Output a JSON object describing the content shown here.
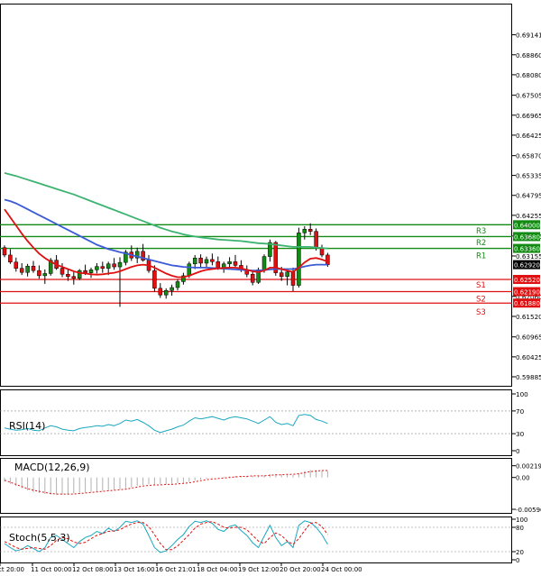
{
  "chart_data": [
    {
      "type": "candlestick",
      "title": "",
      "ylim": [
        0.59885,
        0.69741
      ],
      "y_ticks": [
        "0.69141",
        "0.68860",
        "0.68080",
        "0.67505",
        "0.66965",
        "0.66425",
        "0.65870",
        "0.65335",
        "0.64795",
        "0.64255",
        "0.63695",
        "0.63155",
        "0.62060",
        "0.61520",
        "0.60965",
        "0.60425",
        "0.59885"
      ],
      "x_tick_labels": [
        "ct 20:00",
        "11 Oct 00:00",
        "12 Oct 08:00",
        "13 Oct 16:00",
        "16 Oct 21:01",
        "18 Oct 04:00",
        "19 Oct 12:00",
        "20 Oct 20:00",
        "24 Oct 00:00"
      ],
      "levels": [
        {
          "name": "R3",
          "value": 0.64,
          "label": "0.64000",
          "color": "#138a13"
        },
        {
          "name": "",
          "value": 0.6368,
          "label": "0.63680",
          "color": "#138a13"
        },
        {
          "name": "R2",
          "value": 0.6336,
          "label": "0.63360",
          "color": "#138a13"
        },
        {
          "name": "R1",
          "value": 0.6336,
          "label": "",
          "color": "#138a13"
        },
        {
          "name": "S1",
          "value": 0.6252,
          "label": "0.62520",
          "color": "#e01010"
        },
        {
          "name": "S2",
          "value": 0.6219,
          "label": "0.62190",
          "color": "#e01010"
        },
        {
          "name": "S3",
          "value": 0.6188,
          "label": "0.61880",
          "color": "#e01010"
        }
      ],
      "current_price": {
        "value": 0.6292,
        "label": "0.62920"
      },
      "candles": [
        [
          0.6338,
          0.6344,
          0.6312,
          0.6318
        ],
        [
          0.6318,
          0.6334,
          0.6294,
          0.6299
        ],
        [
          0.6299,
          0.6311,
          0.6273,
          0.6282
        ],
        [
          0.6282,
          0.6296,
          0.6264,
          0.6271
        ],
        [
          0.6271,
          0.6294,
          0.626,
          0.6288
        ],
        [
          0.6288,
          0.6302,
          0.627,
          0.6276
        ],
        [
          0.6276,
          0.629,
          0.6254,
          0.6262
        ],
        [
          0.6262,
          0.6279,
          0.624,
          0.6268
        ],
        [
          0.6268,
          0.631,
          0.6262,
          0.6304
        ],
        [
          0.6304,
          0.6318,
          0.6278,
          0.6282
        ],
        [
          0.6282,
          0.6296,
          0.6258,
          0.6266
        ],
        [
          0.6266,
          0.6281,
          0.6248,
          0.626
        ],
        [
          0.626,
          0.6272,
          0.6238,
          0.6255
        ],
        [
          0.6255,
          0.628,
          0.625,
          0.6276
        ],
        [
          0.6276,
          0.6292,
          0.6264,
          0.627
        ],
        [
          0.627,
          0.6284,
          0.6256,
          0.6278
        ],
        [
          0.6278,
          0.6296,
          0.6268,
          0.6287
        ],
        [
          0.6287,
          0.63,
          0.627,
          0.6282
        ],
        [
          0.6282,
          0.63,
          0.6264,
          0.6294
        ],
        [
          0.6294,
          0.631,
          0.6278,
          0.6286
        ],
        [
          0.6286,
          0.6312,
          0.6178,
          0.6298
        ],
        [
          0.6298,
          0.6332,
          0.629,
          0.6326
        ],
        [
          0.6326,
          0.6344,
          0.6302,
          0.631
        ],
        [
          0.631,
          0.6338,
          0.6296,
          0.6328
        ],
        [
          0.6328,
          0.6348,
          0.63,
          0.6304
        ],
        [
          0.6304,
          0.6318,
          0.627,
          0.6276
        ],
        [
          0.6276,
          0.629,
          0.6218,
          0.6228
        ],
        [
          0.6228,
          0.6242,
          0.6202,
          0.621
        ],
        [
          0.621,
          0.6228,
          0.62,
          0.6222
        ],
        [
          0.6222,
          0.6238,
          0.6208,
          0.623
        ],
        [
          0.623,
          0.6252,
          0.6222,
          0.6246
        ],
        [
          0.6246,
          0.627,
          0.6238,
          0.6262
        ],
        [
          0.6262,
          0.63,
          0.6256,
          0.6294
        ],
        [
          0.6294,
          0.6318,
          0.628,
          0.631
        ],
        [
          0.631,
          0.632,
          0.6286,
          0.6296
        ],
        [
          0.6296,
          0.6314,
          0.6284,
          0.6306
        ],
        [
          0.6306,
          0.6322,
          0.629,
          0.63
        ],
        [
          0.63,
          0.6314,
          0.6278,
          0.6284
        ],
        [
          0.6284,
          0.63,
          0.627,
          0.6294
        ],
        [
          0.6294,
          0.6312,
          0.6282,
          0.63
        ],
        [
          0.63,
          0.6318,
          0.6284,
          0.629
        ],
        [
          0.629,
          0.6304,
          0.6272,
          0.6278
        ],
        [
          0.6278,
          0.629,
          0.6258,
          0.6266
        ],
        [
          0.6266,
          0.6276,
          0.6236,
          0.6244
        ],
        [
          0.6244,
          0.6284,
          0.624,
          0.6278
        ],
        [
          0.6278,
          0.632,
          0.627,
          0.6314
        ],
        [
          0.6314,
          0.636,
          0.63,
          0.6352
        ],
        [
          0.6352,
          0.6356,
          0.6262,
          0.627
        ],
        [
          0.627,
          0.6286,
          0.6248,
          0.626
        ],
        [
          0.626,
          0.6278,
          0.6236,
          0.6272
        ],
        [
          0.6272,
          0.6284,
          0.622,
          0.6236
        ],
        [
          0.6236,
          0.6392,
          0.623,
          0.6378
        ],
        [
          0.6378,
          0.6396,
          0.636,
          0.6388
        ],
        [
          0.6388,
          0.6404,
          0.6372,
          0.6382
        ],
        [
          0.6382,
          0.639,
          0.633,
          0.6338
        ],
        [
          0.6338,
          0.6346,
          0.6312,
          0.6318
        ],
        [
          0.6318,
          0.6324,
          0.6286,
          0.6292
        ]
      ],
      "ma_fast": [
        0.6442,
        0.642,
        0.6398,
        0.6376,
        0.6356,
        0.6338,
        0.6322,
        0.631,
        0.63,
        0.6292,
        0.6286,
        0.628,
        0.6274,
        0.627,
        0.6268,
        0.6266,
        0.6265,
        0.6266,
        0.6268,
        0.627,
        0.6274,
        0.628,
        0.6286,
        0.629,
        0.6292,
        0.629,
        0.6284,
        0.6276,
        0.6268,
        0.6262,
        0.6258,
        0.6258,
        0.6262,
        0.6268,
        0.6274,
        0.6278,
        0.628,
        0.6282,
        0.6283,
        0.6284,
        0.6284,
        0.6282,
        0.6278,
        0.6274,
        0.6272,
        0.6276,
        0.6284,
        0.6284,
        0.628,
        0.6276,
        0.6272,
        0.6284,
        0.6298,
        0.6308,
        0.631,
        0.6306,
        0.63
      ],
      "ma_mid": [
        0.6468,
        0.6464,
        0.6458,
        0.645,
        0.6442,
        0.6434,
        0.6426,
        0.6418,
        0.641,
        0.6402,
        0.6394,
        0.6386,
        0.6378,
        0.637,
        0.6362,
        0.6354,
        0.6346,
        0.634,
        0.6334,
        0.633,
        0.6326,
        0.6322,
        0.6318,
        0.6314,
        0.631,
        0.6306,
        0.6302,
        0.6298,
        0.6294,
        0.629,
        0.6288,
        0.6286,
        0.6285,
        0.6284,
        0.6284,
        0.6284,
        0.6283,
        0.6282,
        0.6281,
        0.628,
        0.6279,
        0.6278,
        0.6277,
        0.6276,
        0.6276,
        0.6277,
        0.6279,
        0.628,
        0.628,
        0.628,
        0.628,
        0.6283,
        0.6287,
        0.629,
        0.6292,
        0.6292,
        0.6292
      ],
      "ma_slow": [
        0.654,
        0.6536,
        0.6532,
        0.6527,
        0.6522,
        0.6517,
        0.6512,
        0.6507,
        0.6502,
        0.6497,
        0.6492,
        0.6487,
        0.6482,
        0.6476,
        0.647,
        0.6464,
        0.6458,
        0.6452,
        0.6446,
        0.644,
        0.6434,
        0.6428,
        0.6422,
        0.6416,
        0.641,
        0.6404,
        0.6398,
        0.6392,
        0.6387,
        0.6382,
        0.6378,
        0.6374,
        0.6371,
        0.6368,
        0.6366,
        0.6364,
        0.6362,
        0.636,
        0.6359,
        0.6358,
        0.6357,
        0.6356,
        0.6354,
        0.6352,
        0.635,
        0.6349,
        0.6348,
        0.6346,
        0.6344,
        0.6342,
        0.634,
        0.634,
        0.634,
        0.634,
        0.6338,
        0.6337,
        0.6336
      ]
    },
    {
      "type": "line",
      "title": "RSI(14)",
      "ylim": [
        0,
        100
      ],
      "y_ticks": [
        "100",
        "70",
        "30",
        "0"
      ],
      "series": [
        {
          "values": [
            40,
            38,
            36,
            37,
            39,
            36,
            35,
            40,
            44,
            42,
            38,
            36,
            35,
            39,
            41,
            42,
            44,
            43,
            46,
            44,
            48,
            54,
            52,
            55,
            50,
            44,
            36,
            32,
            35,
            38,
            42,
            45,
            52,
            58,
            56,
            58,
            60,
            57,
            54,
            58,
            60,
            58,
            56,
            52,
            48,
            54,
            60,
            50,
            46,
            48,
            44,
            62,
            64,
            62,
            55,
            52,
            48
          ],
          "color": "#1aa7c0"
        }
      ]
    },
    {
      "type": "bar",
      "title": "MACD(12,26,9)",
      "ylim": [
        -0.00596,
        0.00299
      ],
      "y_ticks": [
        "0.002199",
        "0.00",
        "-0.005961"
      ],
      "series": [
        {
          "name": "",
          "values": [
            -0.0008,
            -0.0012,
            -0.0016,
            -0.002,
            -0.0024,
            -0.0027,
            -0.0029,
            -0.0031,
            -0.0032,
            -0.0032,
            -0.0032,
            -0.0031,
            -0.003,
            -0.0029,
            -0.0028,
            -0.0027,
            -0.0026,
            -0.0025,
            -0.0024,
            -0.0023,
            -0.0022,
            -0.002,
            -0.0018,
            -0.0016,
            -0.0014,
            -0.0013,
            -0.0013,
            -0.0013,
            -0.0013,
            -0.0012,
            -0.0011,
            -0.001,
            -0.0008,
            -0.0006,
            -0.0004,
            -0.0002,
            -0.0001,
            0.0,
            0.0001,
            0.0002,
            0.0003,
            0.0003,
            0.0003,
            0.0003,
            0.0003,
            0.0004,
            0.0006,
            0.0006,
            0.0006,
            0.0006,
            0.0005,
            0.0008,
            0.0012,
            0.0014,
            0.0014,
            0.0013,
            0.0012
          ],
          "color": "#b0b0b0"
        },
        {
          "name": "",
          "values": [
            -0.0005,
            -0.0009,
            -0.0013,
            -0.0017,
            -0.0021,
            -0.0024,
            -0.0026,
            -0.0028,
            -0.003,
            -0.0031,
            -0.0031,
            -0.0031,
            -0.0031,
            -0.003,
            -0.0029,
            -0.0028,
            -0.0027,
            -0.0026,
            -0.0025,
            -0.0024,
            -0.0023,
            -0.0022,
            -0.002,
            -0.0018,
            -0.0016,
            -0.0015,
            -0.0014,
            -0.0014,
            -0.0013,
            -0.0013,
            -0.0012,
            -0.0011,
            -0.001,
            -0.0008,
            -0.0006,
            -0.0004,
            -0.0003,
            -0.0002,
            -0.0001,
            0.0,
            0.0001,
            0.0002,
            0.0002,
            0.0003,
            0.0003,
            0.0003,
            0.0004,
            0.0005,
            0.0005,
            0.0006,
            0.0006,
            0.0007,
            0.0009,
            0.0011,
            0.0012,
            0.0013,
            0.0013
          ],
          "color": "#e01010"
        }
      ]
    },
    {
      "type": "line",
      "title": "Stoch(5,5,3)",
      "ylim": [
        0,
        100
      ],
      "y_ticks": [
        "100",
        "80",
        "20",
        "0"
      ],
      "series": [
        {
          "name": "",
          "values": [
            40,
            30,
            22,
            26,
            35,
            28,
            20,
            30,
            55,
            60,
            50,
            40,
            30,
            45,
            55,
            60,
            70,
            65,
            78,
            70,
            80,
            95,
            92,
            96,
            88,
            60,
            30,
            18,
            22,
            35,
            50,
            62,
            82,
            95,
            92,
            96,
            90,
            75,
            70,
            82,
            86,
            72,
            60,
            42,
            30,
            58,
            85,
            55,
            35,
            45,
            30,
            85,
            96,
            92,
            80,
            62,
            38
          ],
          "color": "#1aa7c0"
        },
        {
          "name": "",
          "values": [
            45,
            38,
            30,
            26,
            28,
            30,
            28,
            26,
            35,
            48,
            55,
            52,
            44,
            40,
            43,
            52,
            60,
            65,
            70,
            71,
            74,
            82,
            88,
            92,
            92,
            82,
            62,
            40,
            25,
            25,
            34,
            48,
            62,
            78,
            88,
            92,
            94,
            88,
            80,
            78,
            80,
            80,
            74,
            60,
            46,
            40,
            55,
            66,
            60,
            46,
            38,
            52,
            72,
            90,
            92,
            82,
            62
          ],
          "color": "#e01010"
        }
      ]
    }
  ]
}
